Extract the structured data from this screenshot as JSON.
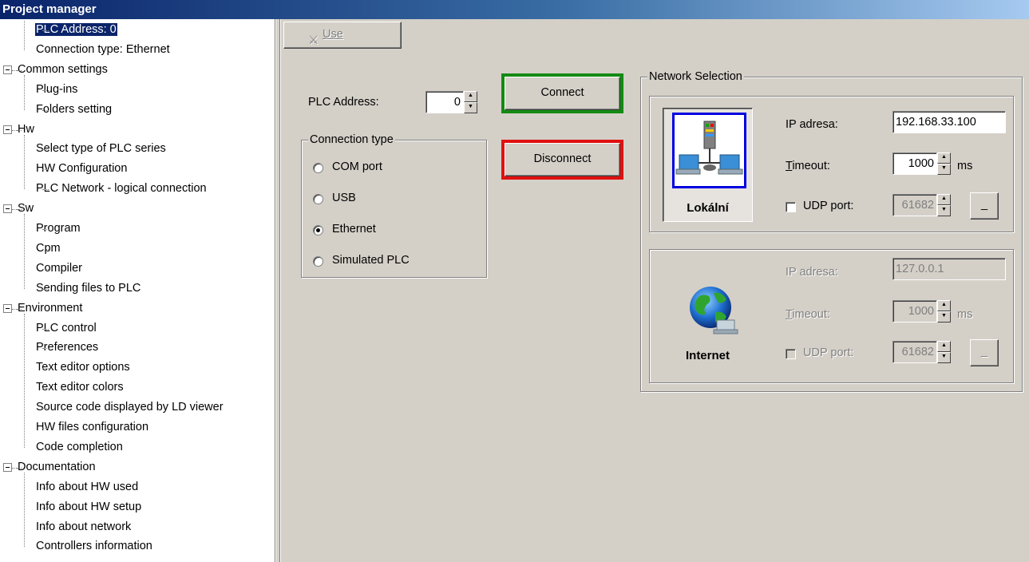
{
  "window": {
    "title": "Project manager"
  },
  "tree": {
    "items": [
      {
        "label": "PLC Address: 0",
        "level": 1,
        "expander": false,
        "selected": true
      },
      {
        "label": "Connection type: Ethernet",
        "level": 1,
        "expander": false
      },
      {
        "label": "Common settings",
        "level": 0,
        "expander": true
      },
      {
        "label": "Plug-ins",
        "level": 1,
        "expander": false
      },
      {
        "label": "Folders setting",
        "level": 1,
        "expander": false
      },
      {
        "label": "Hw",
        "level": 0,
        "expander": true
      },
      {
        "label": "Select type of PLC series",
        "level": 1,
        "expander": false
      },
      {
        "label": "HW Configuration",
        "level": 1,
        "expander": false
      },
      {
        "label": "PLC Network - logical connection",
        "level": 1,
        "expander": false
      },
      {
        "label": "Sw",
        "level": 0,
        "expander": true
      },
      {
        "label": "Program",
        "level": 1,
        "expander": false
      },
      {
        "label": "Cpm",
        "level": 1,
        "expander": false
      },
      {
        "label": "Compiler",
        "level": 1,
        "expander": false
      },
      {
        "label": "Sending files to PLC",
        "level": 1,
        "expander": false
      },
      {
        "label": "Environment",
        "level": 0,
        "expander": true
      },
      {
        "label": "PLC control",
        "level": 1,
        "expander": false
      },
      {
        "label": "Preferences",
        "level": 1,
        "expander": false
      },
      {
        "label": "Text editor options",
        "level": 1,
        "expander": false
      },
      {
        "label": "Text editor colors",
        "level": 1,
        "expander": false
      },
      {
        "label": "Source code displayed by LD viewer",
        "level": 1,
        "expander": false
      },
      {
        "label": "HW files configuration",
        "level": 1,
        "expander": false
      },
      {
        "label": "Code completion",
        "level": 1,
        "expander": false
      },
      {
        "label": "Documentation",
        "level": 0,
        "expander": true
      },
      {
        "label": "Info about HW used",
        "level": 1,
        "expander": false
      },
      {
        "label": "Info about HW setup",
        "level": 1,
        "expander": false
      },
      {
        "label": "Info about network",
        "level": 1,
        "expander": false
      },
      {
        "label": "Controllers information",
        "level": 1,
        "expander": false
      }
    ]
  },
  "toolbar": {
    "use_label": "Use"
  },
  "plc": {
    "address_label": "PLC Address:",
    "address_value": "0",
    "connect_label": "Connect",
    "disconnect_label": "Disconnect",
    "connect_color": "#138a13",
    "disconnect_color": "#e01010"
  },
  "connection_type": {
    "legend": "Connection type",
    "options": [
      {
        "label": "COM port",
        "checked": false
      },
      {
        "label": "USB",
        "checked": false
      },
      {
        "label": "Ethernet",
        "checked": true
      },
      {
        "label": "Simulated PLC",
        "checked": false
      }
    ]
  },
  "network": {
    "legend": "Network Selection",
    "local": {
      "title": "Lokální",
      "ip_label": "IP adresa:",
      "ip_value": "192.168.33.100",
      "timeout_label": "Timeout:",
      "timeout_value": "1000",
      "timeout_unit": "ms",
      "udp_label": "UDP port:",
      "udp_value": "61682",
      "udp_checked": false,
      "browse_label": "_"
    },
    "internet": {
      "title": "Internet",
      "ip_label": "IP adresa:",
      "ip_value": "127.0.0.1",
      "timeout_label": "Timeout:",
      "timeout_value": "1000",
      "timeout_unit": "ms",
      "udp_label": "UDP port:",
      "udp_value": "61682",
      "udp_checked": false,
      "browse_label": "_"
    }
  }
}
